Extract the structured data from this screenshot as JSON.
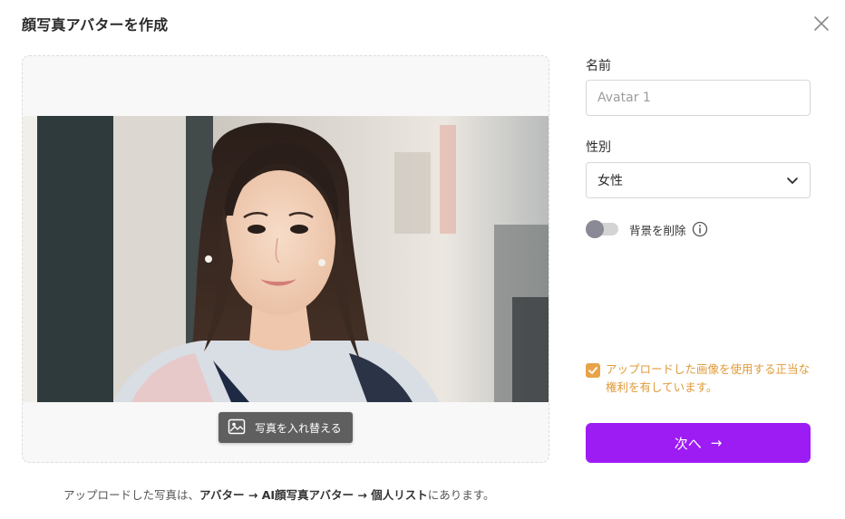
{
  "dialog": {
    "title": "顔写真アバターを作成"
  },
  "upload": {
    "replace_button_label": "写真を入れ替える"
  },
  "footer": {
    "prefix": "アップロードした写真は、",
    "path": "アバター → AI顔写真アバター → 個人リスト",
    "suffix": "にあります。"
  },
  "form": {
    "name_label": "名前",
    "name_value": "",
    "name_placeholder": "Avatar 1",
    "gender_label": "性別",
    "gender_value": "女性",
    "remove_bg_label": "背景を削除",
    "remove_bg_enabled": false,
    "consent_text": "アップロードした画像を使用する正当な権利を有しています。",
    "consent_checked": true,
    "next_label": "次へ",
    "next_arrow": "→"
  },
  "icons": {
    "close": "close-icon",
    "image": "image-icon",
    "chevron": "chevron-down-icon",
    "info": "info-icon",
    "check": "check-icon",
    "arrow": "arrow-right-icon"
  },
  "colors": {
    "primary": "#9d1cf4",
    "consent": "#e09a3a",
    "checkbox": "#e8a34a",
    "toggle_knob": "#8a8a96"
  }
}
